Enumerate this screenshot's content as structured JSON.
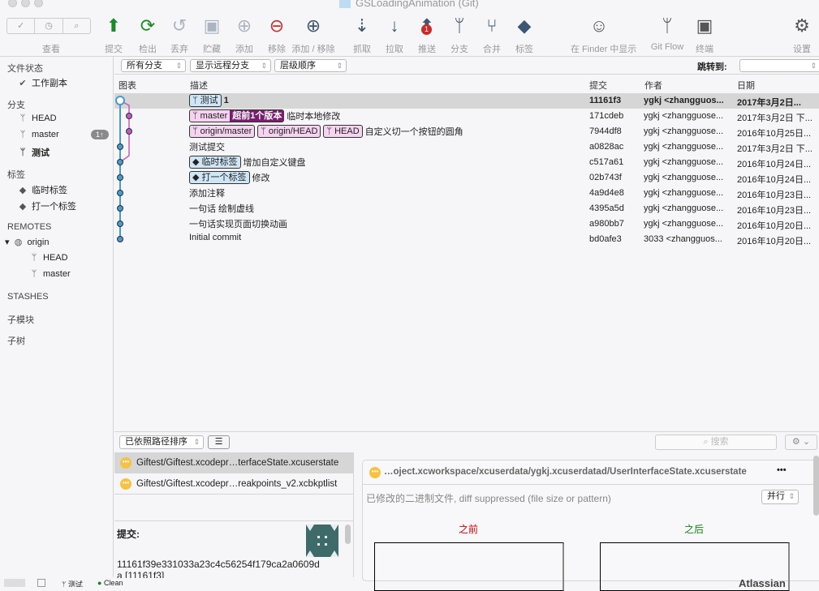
{
  "window": {
    "title": "GSLoadingAnimation (Git)"
  },
  "toolbar": {
    "view_label": "查看",
    "buttons": [
      {
        "label": "提交",
        "icon": "commit-icon"
      },
      {
        "label": "检出",
        "icon": "checkout-icon"
      },
      {
        "label": "丢弃",
        "icon": "discard-icon"
      },
      {
        "label": "贮藏",
        "icon": "stash-icon"
      },
      {
        "label": "添加",
        "icon": "add-icon"
      },
      {
        "label": "移除",
        "icon": "remove-icon"
      },
      {
        "label": "添加 / 移除",
        "icon": "add-remove-icon"
      },
      {
        "label": "抓取",
        "icon": "fetch-icon"
      },
      {
        "label": "拉取",
        "icon": "pull-icon"
      },
      {
        "label": "推送",
        "icon": "push-icon",
        "badge": "1"
      },
      {
        "label": "分支",
        "icon": "branch-icon"
      },
      {
        "label": "合并",
        "icon": "merge-icon"
      },
      {
        "label": "标签",
        "icon": "tag-icon"
      },
      {
        "label": "在 Finder 中显示",
        "icon": "finder-icon"
      },
      {
        "label": "Git Flow",
        "icon": "git-flow-icon"
      },
      {
        "label": "终端",
        "icon": "terminal-icon"
      },
      {
        "label": "设置",
        "icon": "gear-icon"
      }
    ]
  },
  "sidebar": {
    "file_status": "文件状态",
    "working_copy": "工作副本",
    "branches": "分支",
    "branch_items": [
      "HEAD",
      "master",
      "测试"
    ],
    "master_badge": "1↑",
    "tags": "标签",
    "tag_items": [
      "临时标签",
      "打一个标签"
    ],
    "remotes": "REMOTES",
    "origin": "origin",
    "remote_items": [
      "HEAD",
      "master"
    ],
    "stashes": "STASHES",
    "submodules": "子模块",
    "subtrees": "子树"
  },
  "filters": {
    "branches": "所有分支",
    "remote": "显示远程分支",
    "order": "层级顺序",
    "jump_label": "跳转到:"
  },
  "columns": {
    "graph": "图表",
    "desc": "描述",
    "commit": "提交",
    "author": "作者",
    "date": "日期"
  },
  "commits": [
    {
      "refs": [
        {
          "t": "测试",
          "k": "blue",
          "i": "branch"
        }
      ],
      "msg": "1",
      "hash": "11161f3",
      "author": "ygkj <zhangguos...",
      "date": "2017年3月2日..."
    },
    {
      "refs": [
        {
          "t": "master",
          "k": "pink",
          "i": "branch",
          "ahead": "超前1个版本"
        }
      ],
      "msg": "临时本地修改",
      "hash": "171cdeb",
      "author": "ygkj <zhangguose...",
      "date": "2017年3月2日 下..."
    },
    {
      "refs": [
        {
          "t": "origin/master",
          "k": "pink",
          "i": "branch"
        },
        {
          "t": "origin/HEAD",
          "k": "pink",
          "i": "branch"
        },
        {
          "t": "HEAD",
          "k": "pink",
          "i": "branch"
        }
      ],
      "msg": "自定义切一个按钮的圆角",
      "hash": "7944df8",
      "author": "ygkj <zhangguose...",
      "date": "2016年10月25日..."
    },
    {
      "refs": [],
      "msg": "测试提交",
      "hash": "a0828ac",
      "author": "ygkj <zhangguose...",
      "date": "2017年3月2日 下..."
    },
    {
      "refs": [
        {
          "t": "临时标签",
          "k": "blue",
          "i": "tag"
        }
      ],
      "msg": "增加自定义键盘",
      "hash": "c517a61",
      "author": "ygkj <zhangguose...",
      "date": "2016年10月24日..."
    },
    {
      "refs": [
        {
          "t": "打一个标签",
          "k": "blue",
          "i": "tag"
        }
      ],
      "msg": "修改",
      "hash": "02b743f",
      "author": "ygkj <zhangguose...",
      "date": "2016年10月24日..."
    },
    {
      "refs": [],
      "msg": "添加注释",
      "hash": "4a9d4e8",
      "author": "ygkj <zhangguose...",
      "date": "2016年10月23日..."
    },
    {
      "refs": [],
      "msg": "一句话 绘制虚线",
      "hash": "4395a5d",
      "author": "ygkj <zhangguose...",
      "date": "2016年10月23日..."
    },
    {
      "refs": [],
      "msg": "一句话实现页面切换动画",
      "hash": "a980bb7",
      "author": "ygkj <zhangguose...",
      "date": "2016年10月20日..."
    },
    {
      "refs": [],
      "msg": "Initial commit",
      "hash": "bd0afe3",
      "author": "3033 <zhangguos...",
      "date": "2016年10月20日..."
    }
  ],
  "lower": {
    "sort": "已依照路径排序",
    "search_placeholder": "搜索",
    "files": [
      "Giftest/Giftest.xcodepr…terfaceState.xcuserstate",
      "Giftest/Giftest.xcodepr…reakpoints_v2.xcbkptlist"
    ],
    "commit_label": "提交:",
    "commit_hash": "11161f39e331033a23c4c56254f179ca2a0609d",
    "commit_hash2": "a [11161f3]"
  },
  "diff": {
    "path": "…oject.xcworkspace/xcuserdata/ygkj.xcuserdatad/UserInterfaceState.xcuserstate",
    "more": "•••",
    "message": "已修改的二进制文件, diff suppressed (file size or pattern)",
    "mode": "并行",
    "before": "之前",
    "after": "之后"
  },
  "status": {
    "branch": "测试",
    "state": "Clean",
    "brand": "Atlassian"
  },
  "colors": {
    "main_lane": "#4a9bc7",
    "side_lane": "#c55bb8",
    "before": "#cc0000",
    "after": "#118811"
  }
}
